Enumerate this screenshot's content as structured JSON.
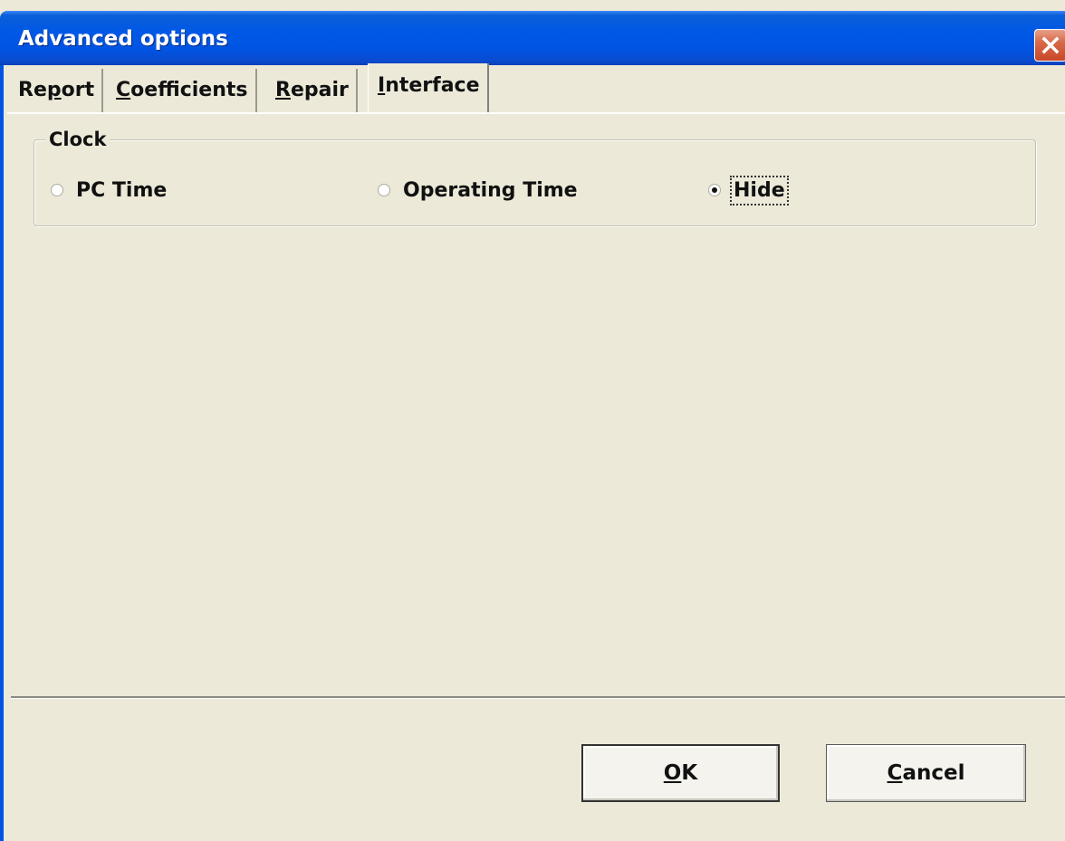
{
  "window": {
    "title": "Advanced options"
  },
  "tabs": [
    {
      "label_pre": "Re",
      "label_mnemonic": "p",
      "label_post": "ort",
      "active": false
    },
    {
      "label_pre": "",
      "label_mnemonic": "C",
      "label_post": "oefficients",
      "active": false
    },
    {
      "label_pre": "",
      "label_mnemonic": "R",
      "label_post": "epair",
      "active": false
    },
    {
      "label_pre": "",
      "label_mnemonic": "I",
      "label_post": "nterface",
      "active": true
    }
  ],
  "clock": {
    "legend": "Clock",
    "options": [
      {
        "label": "PC Time",
        "checked": false
      },
      {
        "label": "Operating Time",
        "checked": false
      },
      {
        "label": "Hide",
        "checked": true
      }
    ]
  },
  "buttons": {
    "ok_mnemonic": "O",
    "ok_rest": "K",
    "cancel_mnemonic": "C",
    "cancel_rest": "ancel"
  },
  "colors": {
    "titlebar": "#0054e3",
    "face": "#ece9d8",
    "close": "#c8482a"
  }
}
